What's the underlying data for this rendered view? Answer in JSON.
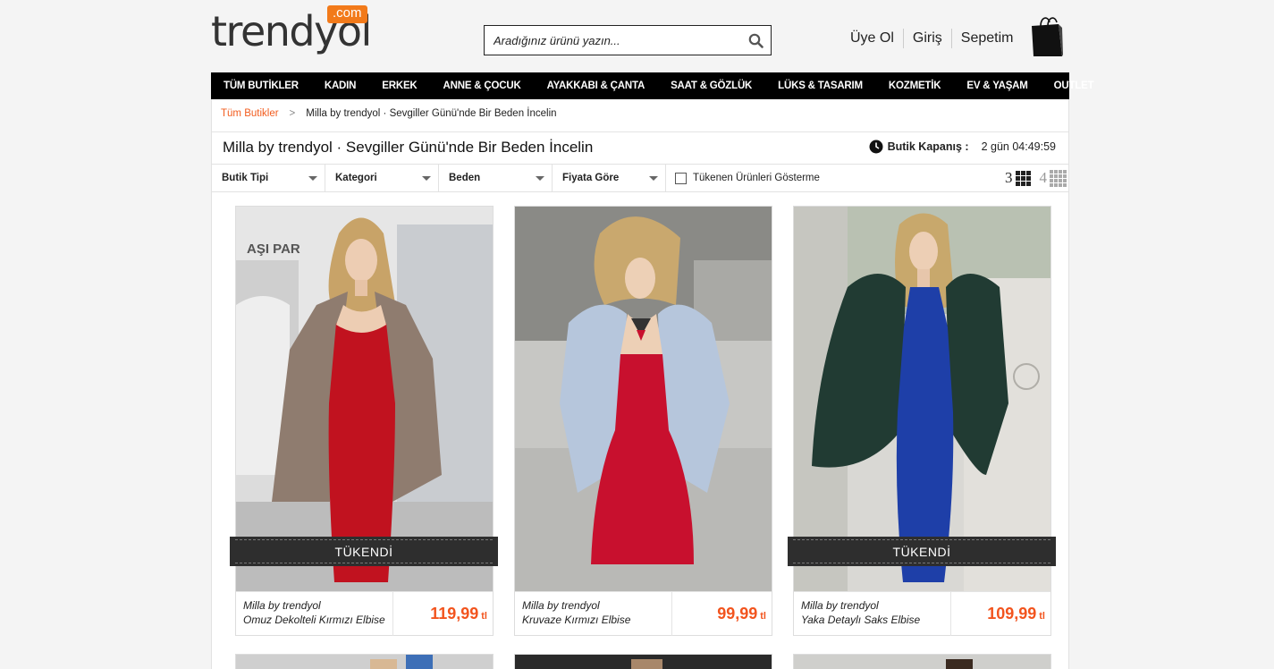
{
  "header": {
    "logo_text": "trendyol",
    "logo_com": ".com",
    "search_placeholder": "Aradığınız ürünü yazın...",
    "links": [
      "Üye Ol",
      "Giriş",
      "Sepetim"
    ]
  },
  "nav": [
    "TÜM BUTİKLER",
    "KADIN",
    "ERKEK",
    "ANNE & ÇOCUK",
    "AYAKKABI & ÇANTA",
    "SAAT & GÖZLÜK",
    "LÜKS & TASARIM",
    "KOZMETİK",
    "EV & YAŞAM",
    "OUTLET"
  ],
  "breadcrumb": {
    "home": "Tüm Butikler",
    "separator": ">",
    "current": "Milla by trendyol · Sevgiller Günü'nde Bir Beden İncelin"
  },
  "boutique": {
    "title": "Milla by trendyol · Sevgiller Günü'nde Bir Beden İncelin",
    "closing_label": "Butik Kapanış :",
    "closing_time": "2 gün 04:49:59"
  },
  "filters": [
    "Butik Tipi",
    "Kategori",
    "Beden",
    "Fiyata Göre"
  ],
  "hide_soldout_label": "Tükenen Ürünleri Gösterme",
  "grid_options": [
    "3",
    "4"
  ],
  "soldout_label": "TÜKENDİ",
  "currency": "tl",
  "products": [
    {
      "brand": "Milla by trendyol",
      "name": "Omuz Dekolteli Kırmızı Elbise",
      "price": "119,99",
      "sold_out": true,
      "dress_color": "#c1121f",
      "outer": "coat"
    },
    {
      "brand": "Milla by trendyol",
      "name": "Kruvaze Kırmızı Elbise",
      "price": "99,99",
      "sold_out": false,
      "dress_color": "#c8102e",
      "outer": "fur"
    },
    {
      "brand": "Milla by trendyol",
      "name": "Yaka Detaylı Saks Elbise",
      "price": "109,99",
      "sold_out": true,
      "dress_color": "#1e3fa8",
      "outer": "green-fur"
    }
  ],
  "colors": {
    "accent": "#f27a1a",
    "price": "#f2541e",
    "nav_bg": "#000000"
  }
}
